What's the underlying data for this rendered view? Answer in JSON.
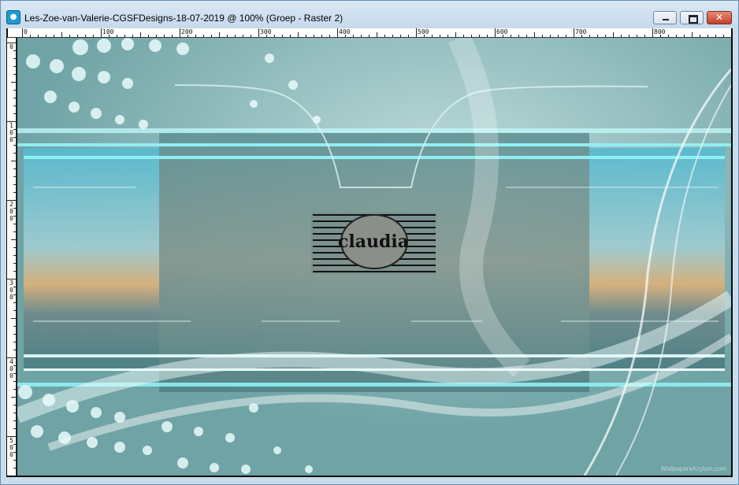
{
  "window": {
    "title": "Les-Zoe-van-Valerie-CGSFDesigns-18-07-2019 @ 100% (Groep - Raster 2)",
    "app_icon": "psp-icon",
    "controls": {
      "minimize": "minimize-icon",
      "maximize": "maximize-icon",
      "close": "close-icon",
      "close_glyph": "✕"
    }
  },
  "ruler": {
    "top_labels": [
      "0",
      "100",
      "200",
      "300",
      "400",
      "500",
      "600",
      "700",
      "800"
    ],
    "left_labels": [
      [
        "0"
      ],
      [
        "1",
        "0",
        "0"
      ],
      [
        "2",
        "0",
        "0"
      ],
      [
        "3",
        "0",
        "0"
      ],
      [
        "4",
        "0",
        "0"
      ],
      [
        "5",
        "0",
        "0"
      ]
    ]
  },
  "canvas": {
    "logo_text": "claudia",
    "watermark": "WallpapersAzylum.com"
  }
}
